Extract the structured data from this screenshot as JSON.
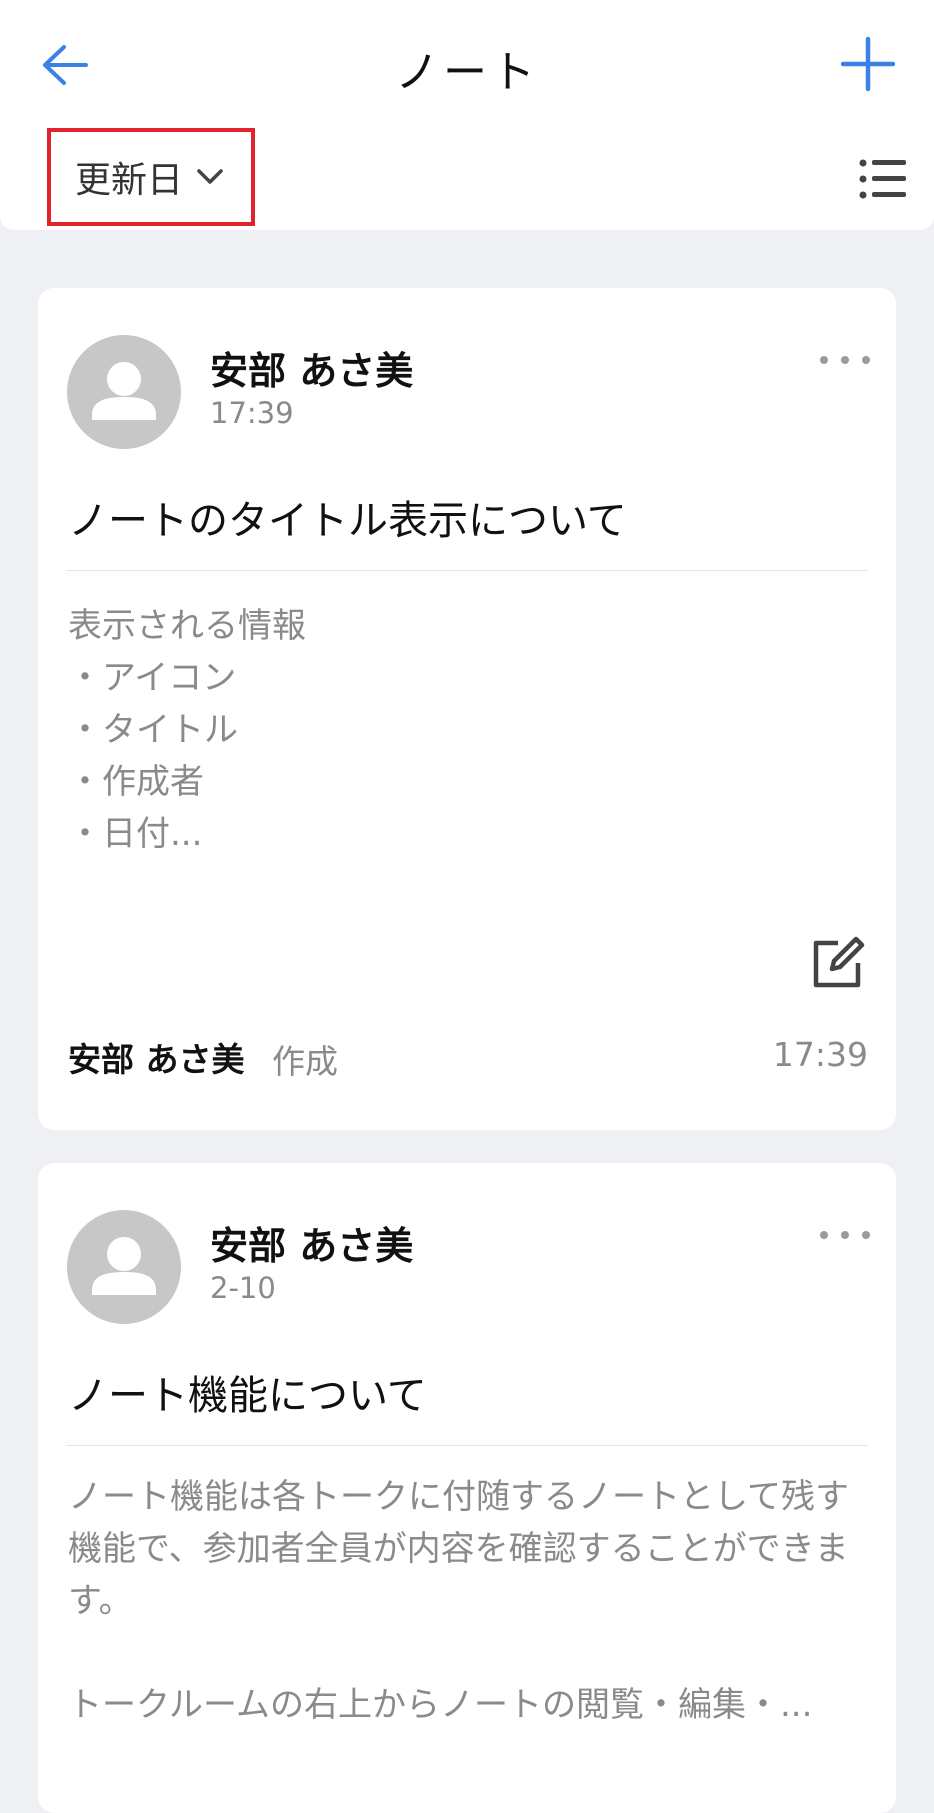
{
  "header": {
    "title": "ノート",
    "back_icon": "arrow-left-icon",
    "add_icon": "plus-icon"
  },
  "sortbar": {
    "sort_label": "更新日",
    "sort_icon": "chevron-down-icon",
    "view_toggle_icon": "list-view-icon"
  },
  "colors": {
    "accent": "#3b82e6",
    "highlight_border": "#e0232d",
    "background": "#eff0f4",
    "muted_text": "#8a8a8a"
  },
  "notes": [
    {
      "author": "安部 あさ美",
      "time": "17:39",
      "title": "ノートのタイトル表示について",
      "body": "表示される情報\n・アイコン\n・タイトル\n・作成者\n・日付...",
      "footer_author": "安部 あさ美",
      "footer_action": "作成",
      "footer_time": "17:39"
    },
    {
      "author": "安部 あさ美",
      "time": "2-10",
      "title": "ノート機能について",
      "body": "ノート機能は各トークに付随するノートとして残す機能で、参加者全員が内容を確認することができます。\n\nトークルームの右上からノートの閲覧・編集・..."
    }
  ]
}
